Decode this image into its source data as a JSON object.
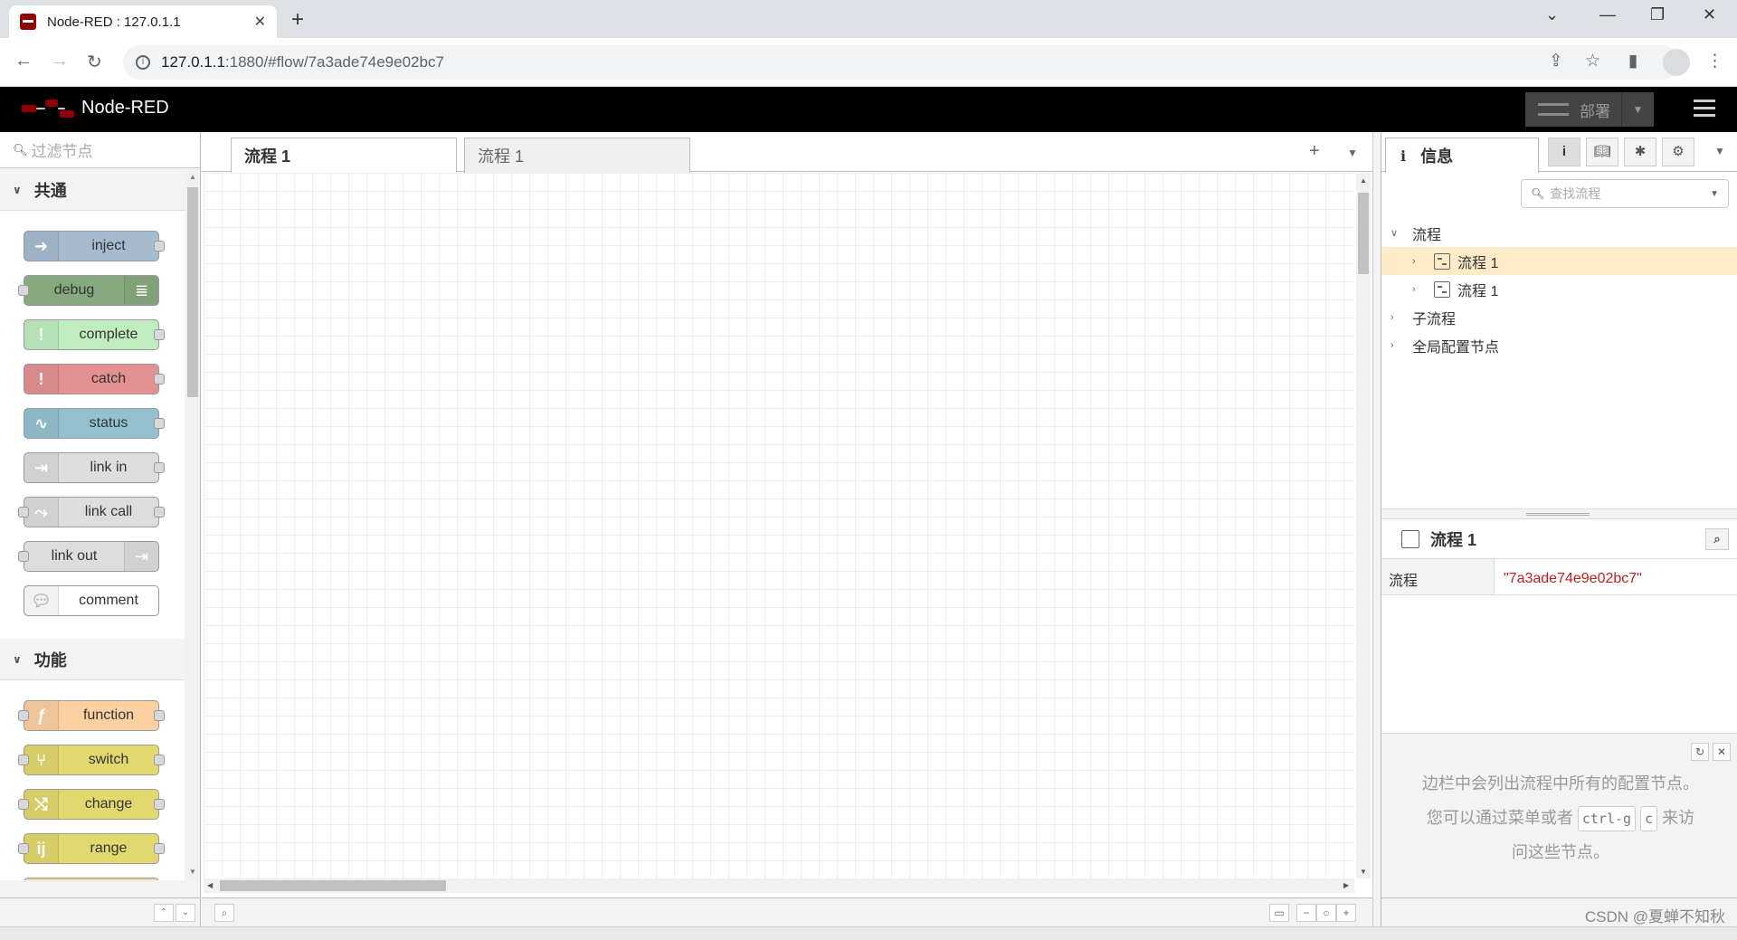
{
  "browser": {
    "tab_title": "Node-RED : 127.0.1.1",
    "tab_close": "✕",
    "new_tab": "+",
    "url_host": "127.0.1.1",
    "url_rest": ":1880/#flow/7a3ade74e9e02bc7"
  },
  "header": {
    "app_title": "Node-RED",
    "deploy_label": "部署"
  },
  "palette": {
    "filter_placeholder": "过滤节点",
    "categories": [
      {
        "label": "共通",
        "nodes": [
          {
            "label": "inject",
            "color": "#a6bbcf"
          },
          {
            "label": "debug",
            "color": "#87a980"
          },
          {
            "label": "complete",
            "color": "#c0edc0"
          },
          {
            "label": "catch",
            "color": "#e49191"
          },
          {
            "label": "status",
            "color": "#94c1d0"
          },
          {
            "label": "link in",
            "color": "#dddddd"
          },
          {
            "label": "link call",
            "color": "#dddddd"
          },
          {
            "label": "link out",
            "color": "#dddddd"
          },
          {
            "label": "comment",
            "color": "#ffffff"
          }
        ]
      },
      {
        "label": "功能",
        "nodes": [
          {
            "label": "function",
            "color": "#fdd0a2"
          },
          {
            "label": "switch",
            "color": "#e2d96e"
          },
          {
            "label": "change",
            "color": "#e2d96e"
          },
          {
            "label": "range",
            "color": "#e2d96e"
          }
        ]
      }
    ]
  },
  "workspace": {
    "tabs": [
      {
        "label": "流程 1",
        "active": true
      },
      {
        "label": "流程 1",
        "active": false
      }
    ]
  },
  "sidebar": {
    "tab_label": "信息",
    "search_placeholder": "查找流程",
    "tree": {
      "flows_label": "流程",
      "flow_items": [
        "流程 1",
        "流程 1"
      ],
      "subflows_label": "子流程",
      "global_config_label": "全局配置节点"
    },
    "info": {
      "title": "流程 1",
      "prop_key": "流程",
      "prop_value": "\"7a3ade74e9e02bc7\""
    },
    "tip": {
      "line1": "边栏中会列出流程中所有的配置节点。",
      "line2_pre": "您可以通过菜单或者",
      "kbd1": "ctrl-g",
      "kbd2": "c",
      "line2_post": "来访",
      "line3": "问这些节点。"
    },
    "watermark": "CSDN @夏蝉不知秋"
  }
}
